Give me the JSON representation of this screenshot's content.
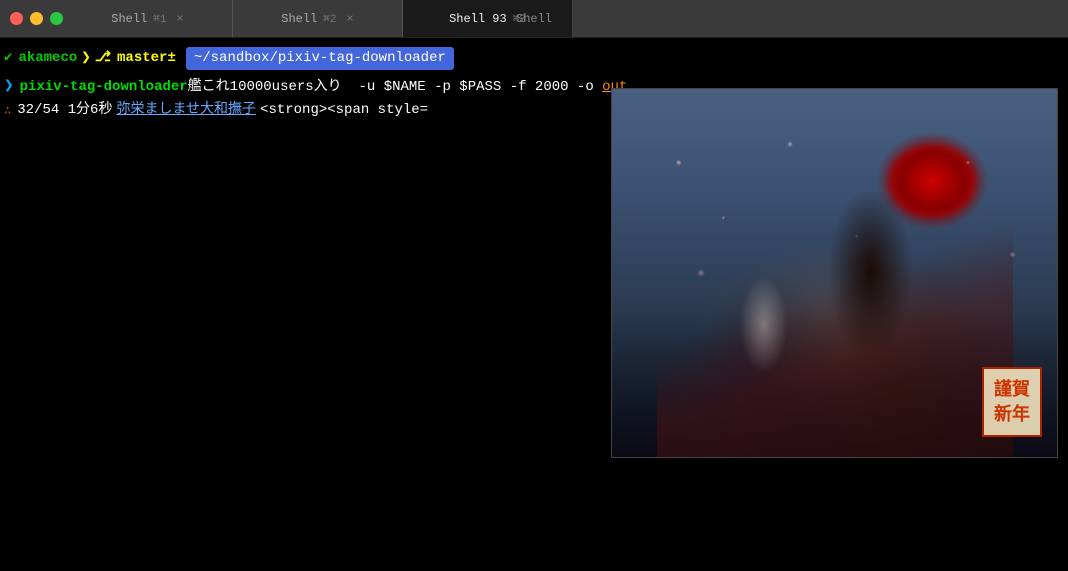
{
  "window": {
    "title": "Shell"
  },
  "titlebar": {
    "controls": {
      "close": "×",
      "minimize": "−",
      "maximize": "+"
    }
  },
  "tabs": [
    {
      "id": "tab1",
      "label": "Shell",
      "shortcut": "⌘1",
      "active": false
    },
    {
      "id": "tab2",
      "label": "Shell",
      "shortcut": "⌘2",
      "active": false
    },
    {
      "id": "tab3",
      "label": "Shell 93",
      "shortcut": "⌘3",
      "active": true
    }
  ],
  "terminal": {
    "prompt": {
      "check": "✔",
      "user": "akameco",
      "arrow": "❯",
      "branch_icon": "⎇",
      "branch": "master±",
      "directory": "~/sandbox/pixiv-tag-downloader"
    },
    "command": {
      "prompt_char": "❯",
      "name": "pixiv-tag-downloader",
      "args": " 艦これ10000users入り  -u $NAME -p $PASS -f 2000 -o out"
    },
    "status": {
      "dot": ":",
      "progress": "32/54  1分6秒",
      "link": "弥栄ましませ大和撫子",
      "html": " <strong><span style="
    }
  }
}
